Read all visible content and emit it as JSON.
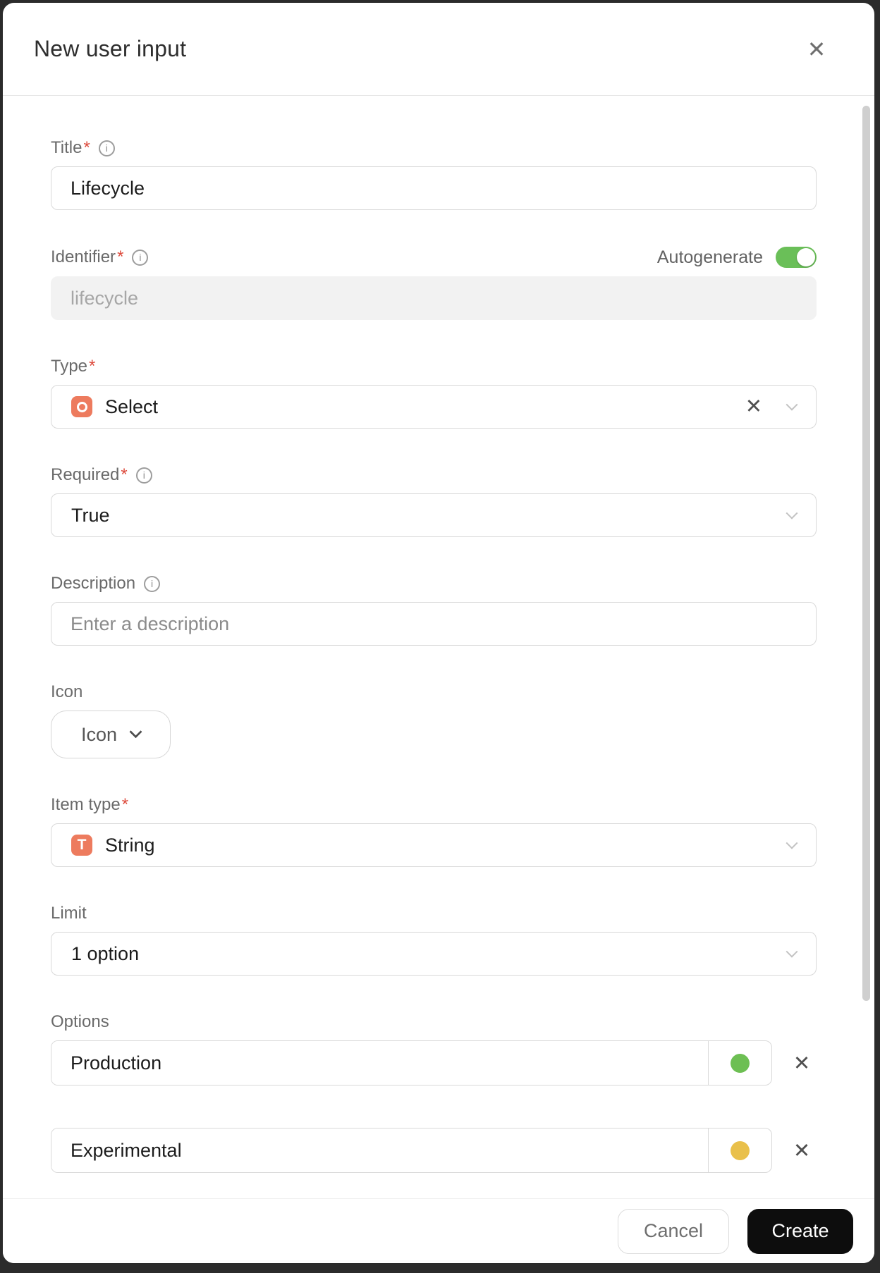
{
  "ui": {
    "required_mark": "*",
    "info_glyph": "i",
    "close_glyph": "✕",
    "clear_glyph": "✕",
    "remove_glyph": "✕"
  },
  "dialog": {
    "title": "New user input"
  },
  "fields": {
    "title": {
      "label": "Title",
      "value": "Lifecycle"
    },
    "identifier": {
      "label": "Identifier",
      "autogenerate_label": "Autogenerate",
      "toggle_state": "on",
      "value": "lifecycle"
    },
    "type": {
      "label": "Type",
      "value": "Select"
    },
    "required": {
      "label": "Required",
      "value": "True"
    },
    "description": {
      "label": "Description",
      "placeholder": "Enter a description"
    },
    "icon": {
      "label": "Icon",
      "button_label": "Icon"
    },
    "item_type": {
      "label": "Item type",
      "value": "String",
      "icon_glyph": "T"
    },
    "limit": {
      "label": "Limit",
      "value": "1 option"
    },
    "options": {
      "label": "Options",
      "items": [
        {
          "value": "Production",
          "color": "#6dbf53"
        },
        {
          "value": "Experimental",
          "color": "#e9c04b"
        }
      ]
    }
  },
  "footer": {
    "cancel_label": "Cancel",
    "create_label": "Create"
  },
  "colors": {
    "toggle_on": "#6abf58",
    "accent_icon": "#ed7b5e",
    "create_button_bg": "#0d0d0d"
  }
}
